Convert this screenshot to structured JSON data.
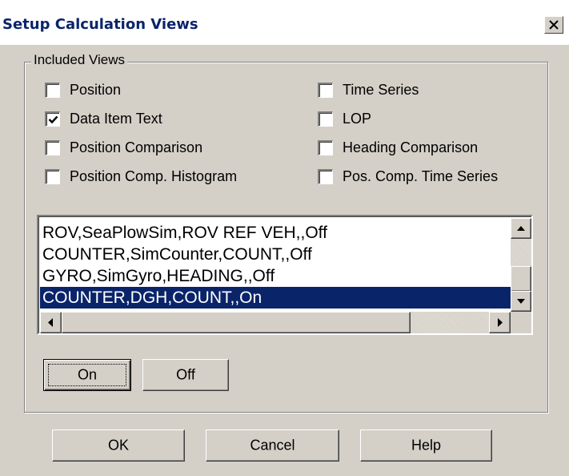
{
  "window": {
    "title": "Setup Calculation Views",
    "close_glyph": "X"
  },
  "included_views": {
    "group_label": "Included Views",
    "options": [
      {
        "label": "Position",
        "checked": false
      },
      {
        "label": "Time Series",
        "checked": false
      },
      {
        "label": "Data Item Text",
        "checked": true
      },
      {
        "label": "LOP",
        "checked": false
      },
      {
        "label": "Position Comparison",
        "checked": false
      },
      {
        "label": "Heading Comparison",
        "checked": false
      },
      {
        "label": "Position Comp. Histogram",
        "checked": false
      },
      {
        "label": "Pos. Comp. Time Series",
        "checked": false
      }
    ]
  },
  "data_items": {
    "items": [
      "ROV,SeaPlowSim,ROV REF VEH,,Off",
      "COUNTER,SimCounter,COUNT,,Off",
      "GYRO,SimGyro,HEADING,,Off",
      "COUNTER,DGH,COUNT,,On"
    ],
    "selected_index": 3
  },
  "toggle_buttons": {
    "on_label": "On",
    "off_label": "Off"
  },
  "dialog_buttons": {
    "ok_label": "OK",
    "cancel_label": "Cancel",
    "help_label": "Help"
  },
  "colors": {
    "face": "#d4d0c8",
    "selection": "#0a246a",
    "title_text": "#0a246a"
  }
}
